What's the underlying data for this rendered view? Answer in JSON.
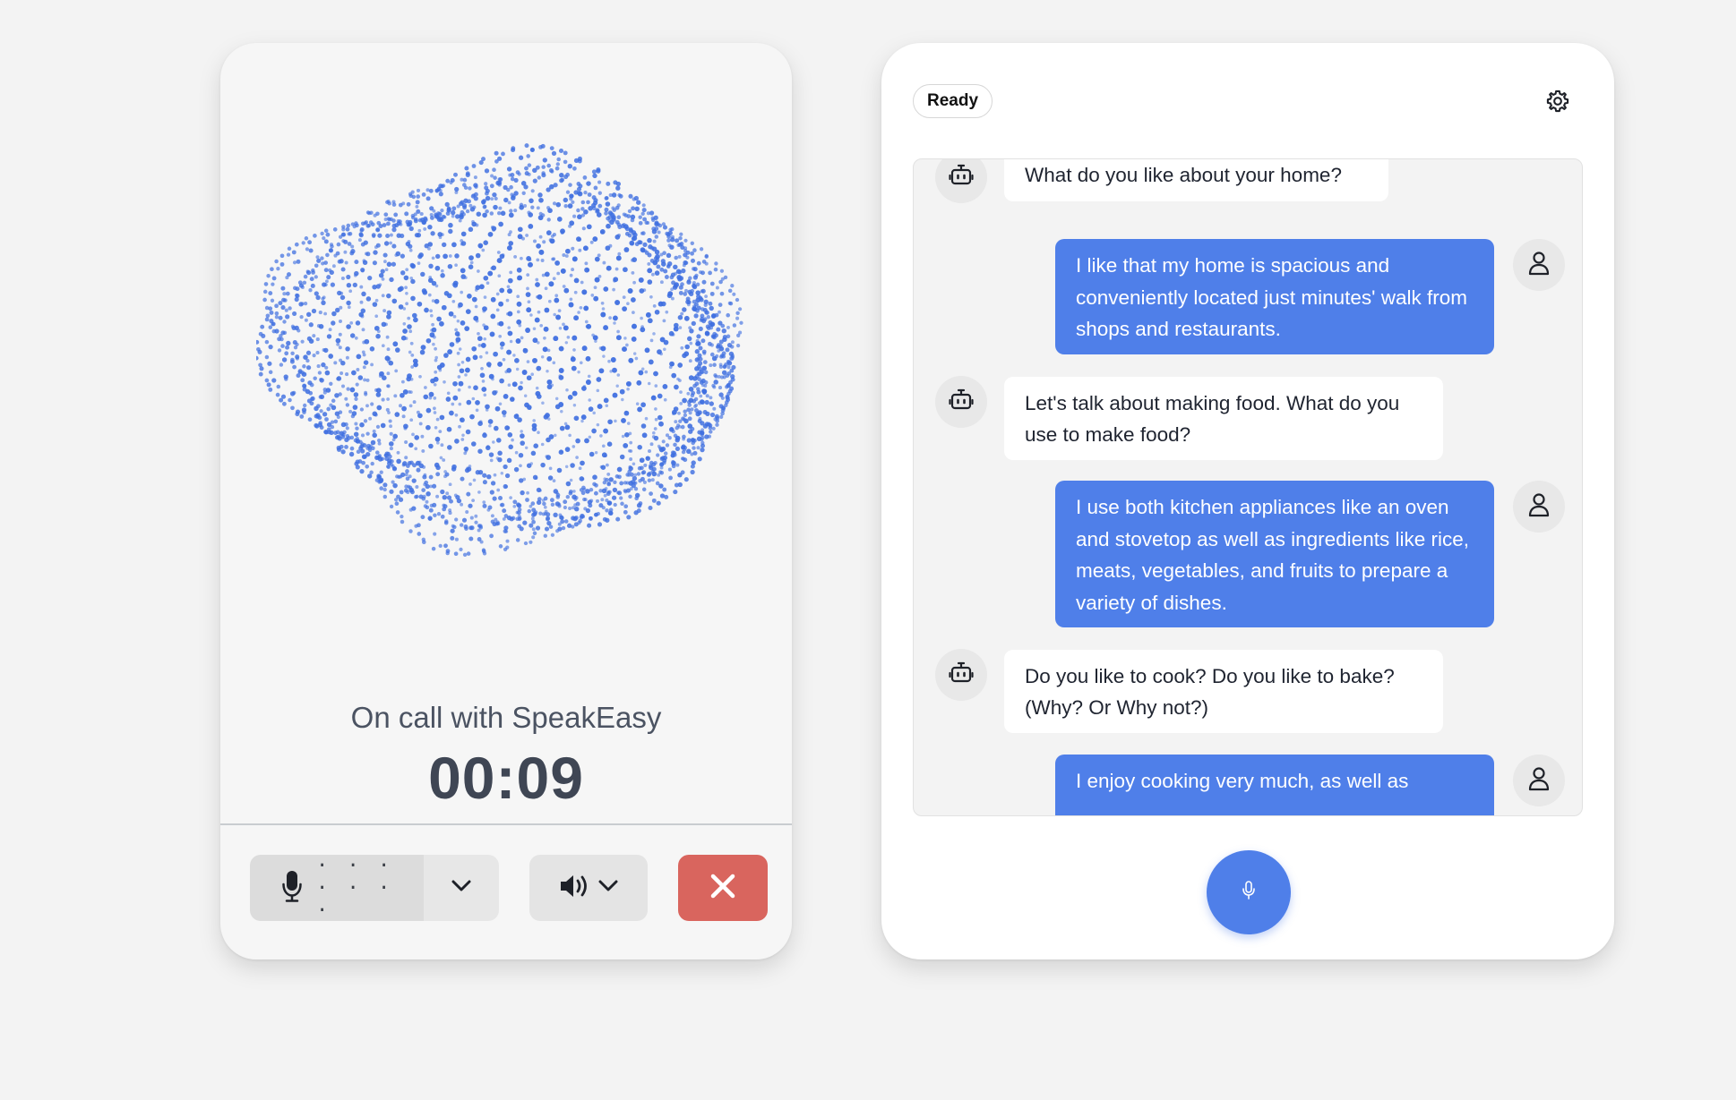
{
  "call_panel": {
    "status_text": "On call with SpeakEasy",
    "timer": "00:09",
    "mic_level_dots": "· · · · · · ·",
    "mic_icon": "microphone-icon",
    "speaker_icon": "speaker-icon",
    "end_icon": "close-icon",
    "colors": {
      "viz_dots": "#3f6fe0",
      "end_button": "#d9655e"
    }
  },
  "chat_panel": {
    "status": "Ready",
    "settings_icon": "gear-icon",
    "record_icon": "microphone-icon",
    "accent_color": "#4f7fe9",
    "messages": [
      {
        "role": "bot",
        "text": "What do you like about your home?"
      },
      {
        "role": "user",
        "text": "I like that my home is spacious and conveniently located just minutes' walk from shops and restaurants."
      },
      {
        "role": "bot",
        "text": "Let's talk about making food. What do you use to make food?"
      },
      {
        "role": "user",
        "text": "I use both kitchen appliances like an oven and stovetop as well as ingredients like rice, meats, vegetables, and fruits to prepare a variety of dishes."
      },
      {
        "role": "bot",
        "text": "Do you like to cook? Do you like to bake? (Why? Or Why not?)"
      },
      {
        "role": "user",
        "text": "I enjoy cooking very much, as well as"
      }
    ]
  }
}
